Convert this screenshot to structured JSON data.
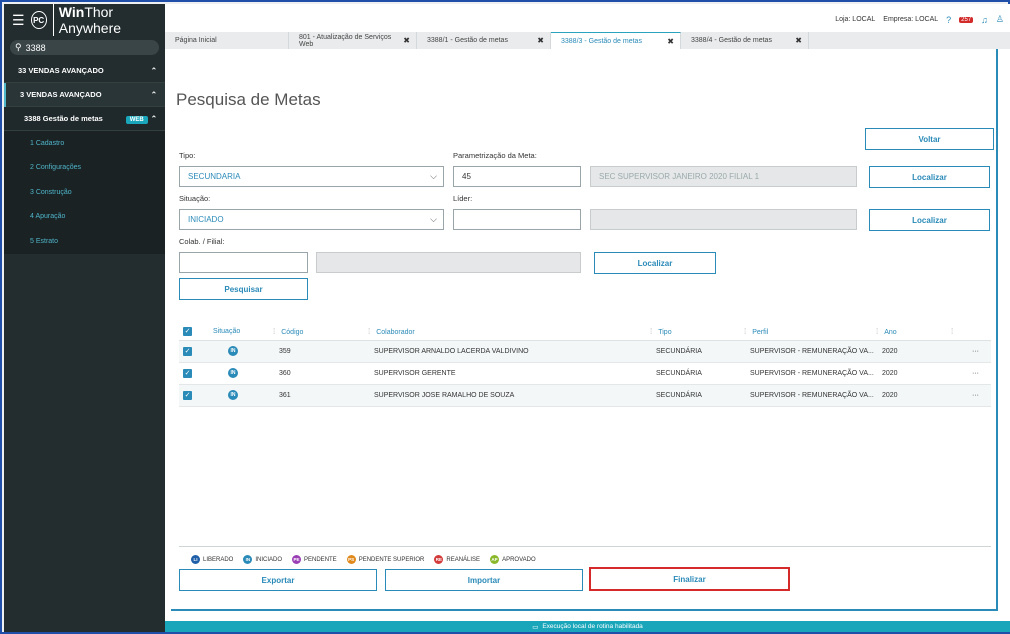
{
  "app": {
    "title_thin": "Thor Anywhere",
    "title_bold": "Win",
    "logo": "PC"
  },
  "sidebar": {
    "search_value": "3388",
    "items": [
      {
        "label": "33  VENDAS AVANÇADO"
      },
      {
        "label": "3  VENDAS AVANÇADO"
      },
      {
        "label": "3388  Gestão de metas",
        "badge": "WEB"
      }
    ],
    "subitems": [
      "1  Cadastro",
      "2  Configurações",
      "3  Construção",
      "4  Apuração",
      "5  Estrato"
    ]
  },
  "topbar": {
    "loja": "Loja: LOCAL",
    "empresa": "Empresa: LOCAL",
    "notif_count": "257"
  },
  "tabs": [
    {
      "label": "Página Inicial",
      "close": ""
    },
    {
      "label": "801 - Atualização de Serviços Web",
      "close": "✖"
    },
    {
      "label": "3388/1 - Gestão de metas",
      "close": "✖"
    },
    {
      "label": "3388/3 - Gestão de metas",
      "close": "✖"
    },
    {
      "label": "3388/4 - Gestão de metas",
      "close": "✖"
    }
  ],
  "page": {
    "title": "Pesquisa de Metas",
    "voltar": "Voltar"
  },
  "form": {
    "tipo_label": "Tipo:",
    "tipo_value": "SECUNDARIA",
    "param_label": "Parametrização da Meta:",
    "param_value": "45",
    "param_desc": "SEC SUPERVISOR JANEIRO 2020 FILIAL 1",
    "situacao_label": "Situação:",
    "situacao_value": "INICIADO",
    "lider_label": "Líder:",
    "lider_value": "",
    "lider_desc": "",
    "colab_label": "Colab. / Filial:",
    "colab_value": "",
    "colab_desc": "",
    "localizar": "Localizar",
    "pesquisar": "Pesquisar"
  },
  "table": {
    "headers": [
      "Situação",
      "Código",
      "Colaborador",
      "Tipo",
      "Perfil",
      "Ano"
    ],
    "rows": [
      {
        "status": "IN",
        "codigo": "359",
        "colaborador": "SUPERVISOR ARNALDO LACERDA VALDIVINO",
        "tipo": "SECUNDÁRIA",
        "perfil": "SUPERVISOR - REMUNERAÇÃO VA...",
        "ano": "2020",
        "more": "···"
      },
      {
        "status": "IN",
        "codigo": "360",
        "colaborador": "SUPERVISOR GERENTE",
        "tipo": "SECUNDÁRIA",
        "perfil": "SUPERVISOR - REMUNERAÇÃO VA...",
        "ano": "2020",
        "more": "···"
      },
      {
        "status": "IN",
        "codigo": "361",
        "colaborador": "SUPERVISOR JOSE RAMALHO DE SOUZA",
        "tipo": "SECUNDÁRIA",
        "perfil": "SUPERVISOR - REMUNERAÇÃO VA...",
        "ano": "2020",
        "more": "···"
      }
    ]
  },
  "legend": [
    {
      "code": "LI",
      "label": "LIBERADO",
      "color": "#1f5fa8"
    },
    {
      "code": "IN",
      "label": "INICIADO",
      "color": "#2a8ab8"
    },
    {
      "code": "PE",
      "label": "PENDENTE",
      "color": "#9b3fb5"
    },
    {
      "code": "PS",
      "label": "PENDENTE SUPERIOR",
      "color": "#e08a1e"
    },
    {
      "code": "RE",
      "label": "REANÁLISE",
      "color": "#d33a3a"
    },
    {
      "code": "AP",
      "label": "APROVADO",
      "color": "#8ab82a"
    }
  ],
  "actions": {
    "exportar": "Exportar",
    "importar": "Importar",
    "finalizar": "Finalizar"
  },
  "status_bar": "Execução local de rotina habilitada"
}
